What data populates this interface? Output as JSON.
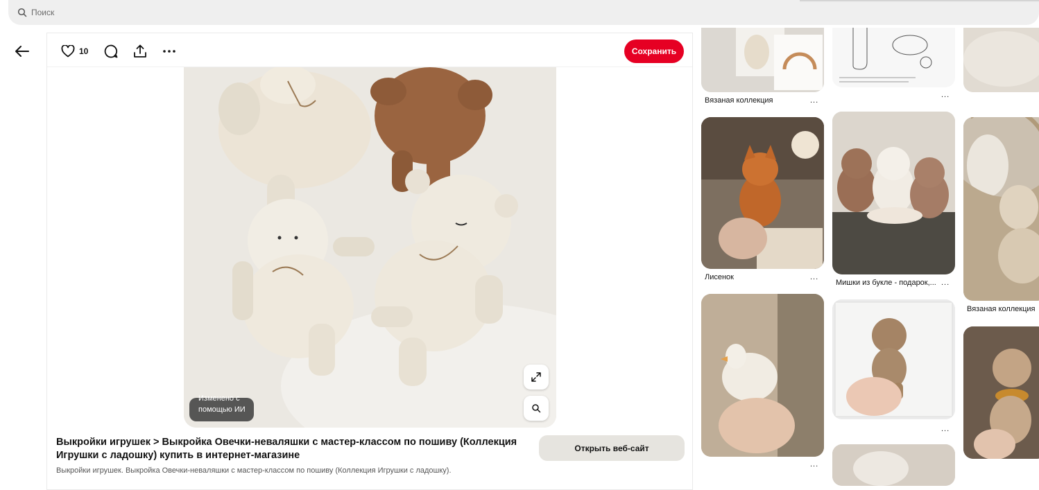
{
  "search": {
    "placeholder": "Поиск"
  },
  "toolbar": {
    "like_count": "10",
    "save_label": "Сохранить"
  },
  "pin": {
    "ai_badge": "Изменено с помощью ИИ",
    "title": "Выкройки игрушек > Выкройка Овечки-неваляшки с мастер-классом по пошиву (Коллекция Игрушки с ладошку) купить в интернет-магазине",
    "open_site_label": "Открыть веб-сайт",
    "description": "Выкройки игрушек. Выкройка Овечки-неваляшки с мастер-классом по пошиву (Коллекция Игрушки с ладошку)."
  },
  "grid": {
    "more": "...",
    "items": [
      {
        "label": "Вязаная коллекция"
      },
      {
        "label": ""
      },
      {
        "label": ""
      },
      {
        "label": "Лисенок"
      },
      {
        "label": "Мишки из букле - подарок,..."
      },
      {
        "label": "Вязаная коллекция"
      },
      {
        "label": ""
      },
      {
        "label": ""
      },
      {
        "label": ""
      },
      {
        "label": ""
      }
    ]
  },
  "colors": {
    "save": "#e60023",
    "search_bg": "#efefef",
    "open_site_bg": "#e6e4df"
  },
  "icons": [
    "search-icon",
    "back-arrow-icon",
    "heart-icon",
    "comment-icon",
    "share-icon",
    "more-icon",
    "expand-icon",
    "visual-search-icon"
  ]
}
